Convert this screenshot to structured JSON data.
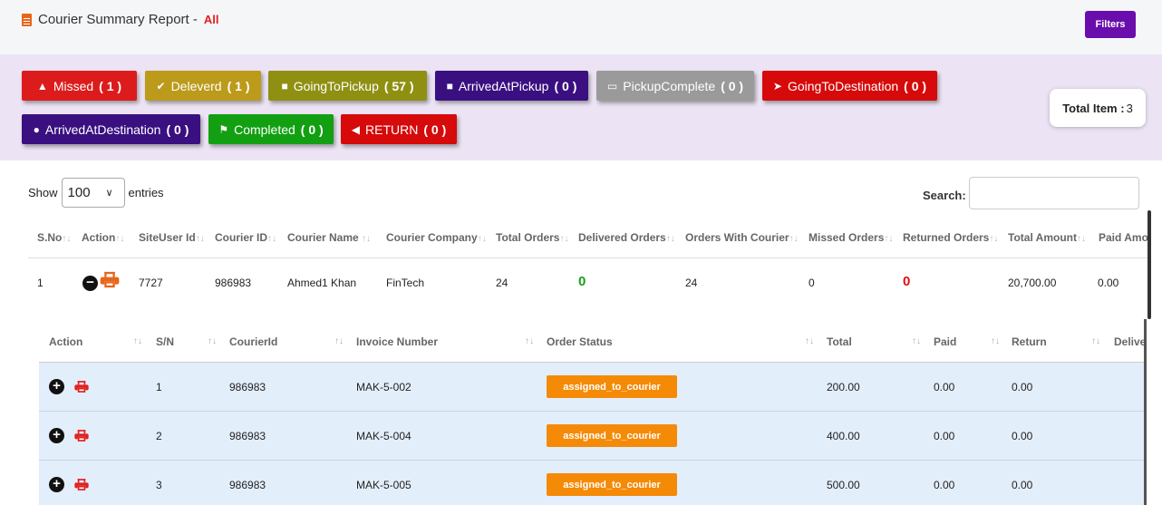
{
  "header": {
    "title": "Courier Summary Report -",
    "scope": "All",
    "filters_label": "Filters"
  },
  "status_buttons": [
    {
      "label": "Missed",
      "count": "( 1 )",
      "icon": "warning-icon",
      "color": "#dc1c1c"
    },
    {
      "label": "Deleverd",
      "count": "( 1 )",
      "icon": "check-circle-icon",
      "color": "#bc9a1a"
    },
    {
      "label": "GoingToPickup",
      "count": "( 57 )",
      "icon": "truck-icon",
      "color": "#8f9012"
    },
    {
      "label": "ArrivedAtPickup",
      "count": "( 0 )",
      "icon": "briefcase-icon",
      "color": "#3a1080"
    },
    {
      "label": "PickupComplete",
      "count": "( 0 )",
      "icon": "inbox-icon",
      "color": "#9a9a9a"
    },
    {
      "label": "GoingToDestination",
      "count": "( 0 )",
      "icon": "location-arrow-icon",
      "color": "#d60a0a"
    },
    {
      "label": "ArrivedAtDestination",
      "count": "( 0 )",
      "icon": "map-marker-icon",
      "color": "#3a1080"
    },
    {
      "label": "Completed",
      "count": "( 0 )",
      "icon": "flag-icon",
      "color": "#12a012"
    },
    {
      "label": "RETURN",
      "count": "( 0 )",
      "icon": "arrow-circle-left-icon",
      "color": "#d60a0a"
    }
  ],
  "total": {
    "label": "Total Item :",
    "value": "3"
  },
  "length": {
    "show": "Show",
    "value": "100",
    "entries": "entries"
  },
  "search": {
    "label": "Search:",
    "value": ""
  },
  "main_table": {
    "headers": [
      "S.No",
      "Action",
      "SiteUser Id",
      "Courier ID",
      "Courier Name",
      "Courier Company",
      "Total Orders",
      "Delivered Orders",
      "Orders With Courier",
      "Missed Orders",
      "Returned Orders",
      "Total Amount",
      "Paid Amo"
    ],
    "row": {
      "sno": "1",
      "siteuser": "7727",
      "courier_id": "986983",
      "courier_name": "Ahmed1 Khan",
      "company": "FinTech",
      "total_orders": "24",
      "delivered": "0",
      "with_courier": "24",
      "missed": "0",
      "returned": "0",
      "total_amount": "20,700.00",
      "paid": "0.00"
    }
  },
  "sub_table": {
    "headers": [
      "Action",
      "S/N",
      "CourierId",
      "Invoice Number",
      "Order Status",
      "Total",
      "Paid",
      "Return",
      "Delive"
    ],
    "rows": [
      {
        "sn": "1",
        "courier": "986983",
        "invoice": "MAK-5-002",
        "status": "assigned_to_courier",
        "total": "200.00",
        "paid": "0.00",
        "ret": "0.00"
      },
      {
        "sn": "2",
        "courier": "986983",
        "invoice": "MAK-5-004",
        "status": "assigned_to_courier",
        "total": "400.00",
        "paid": "0.00",
        "ret": "0.00"
      },
      {
        "sn": "3",
        "courier": "986983",
        "invoice": "MAK-5-005",
        "status": "assigned_to_courier",
        "total": "500.00",
        "paid": "0.00",
        "ret": "0.00"
      }
    ]
  },
  "colors": {
    "accent": "#6a0dad",
    "status_badge": "#f58a07",
    "print_icon": "#e8651a"
  }
}
